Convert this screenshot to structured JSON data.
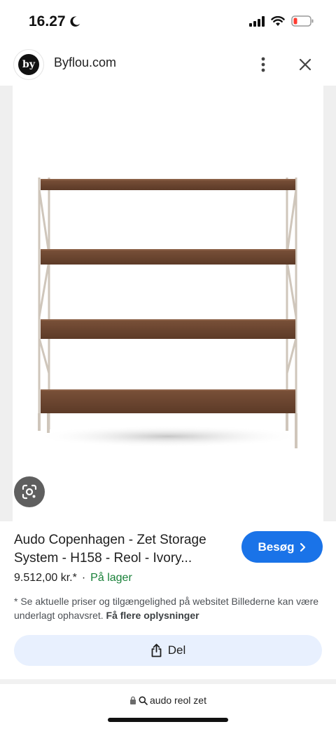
{
  "status_bar": {
    "time": "16.27",
    "icons": [
      "moon-icon",
      "signal-icon",
      "wifi-icon",
      "battery-low-icon"
    ],
    "battery_color": "#ff3b30"
  },
  "site": {
    "logo_text": "by",
    "name": "Byflou.com",
    "icons": [
      "more-vert-icon",
      "close-icon"
    ]
  },
  "product": {
    "title": "Audo Copenhagen - Zet Storage System - H158 - Reol - Ivory...",
    "price": "9.512,00 kr.*",
    "separator": "·",
    "stock": "På lager",
    "visit_label": "Besøg",
    "visit_icon": "chevron-right-icon",
    "lens_icon": "google-lens-icon"
  },
  "disclaimer": {
    "text": "* Se aktuelle priser og tilgængelighed på websitet Billederne kan være underlagt ophavsret.",
    "more_link": "Få flere oplysninger"
  },
  "share": {
    "label": "Del",
    "icon": "share-icon"
  },
  "url_bar": {
    "query": "audo reol zet",
    "icons": [
      "lock-icon",
      "search-icon"
    ]
  },
  "colors": {
    "accent": "#1a73e8",
    "stock_green": "#188038",
    "share_bg": "#e8f0fe",
    "shelf_wood": "#6b4530",
    "frame": "#cfc6bb"
  }
}
